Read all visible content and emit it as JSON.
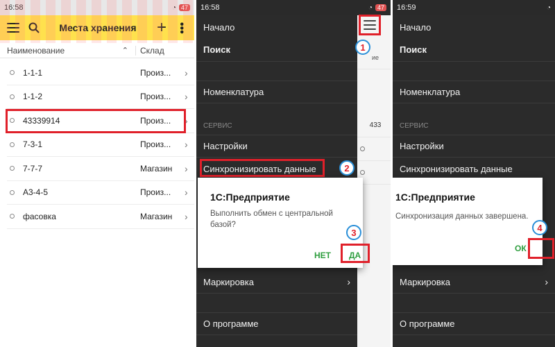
{
  "screen1": {
    "status_time": "16:58",
    "status_right": "47",
    "title": "Места хранения",
    "icons": {
      "menu": "hamburger-menu-icon",
      "search": "search-icon",
      "add": "plus-icon",
      "more": "more-vert-icon"
    },
    "columns": {
      "name": "Наименование",
      "sort_indicator": "^",
      "warehouse": "Склад"
    },
    "rows": [
      {
        "name": "1-1-1",
        "wh": "Произ..."
      },
      {
        "name": "1-1-2",
        "wh": "Произ..."
      },
      {
        "name": "43339914",
        "wh": "Произ..."
      },
      {
        "name": "7-3-1",
        "wh": "Произ..."
      },
      {
        "name": "7-7-7",
        "wh": "Магазин"
      },
      {
        "name": "А3-4-5",
        "wh": "Произ..."
      },
      {
        "name": "фасовка",
        "wh": "Магазин"
      }
    ]
  },
  "screen2": {
    "status_time": "16:58",
    "status_right": "47",
    "menu": {
      "start": "Начало",
      "search": "Поиск",
      "nomenclature": "Номенклатура",
      "service_header": "СЕРВИС",
      "settings": "Настройки",
      "sync": "Синхронизировать данные",
      "marking": "Маркировка",
      "about": "О программе"
    },
    "dialog": {
      "title": "1С:Предприятие",
      "message": "Выполнить обмен с центральной базой?",
      "no": "НЕТ",
      "yes": "ДА"
    },
    "strip_rows": [
      {
        "text": ""
      },
      {
        "text": ""
      },
      {
        "text": ""
      }
    ]
  },
  "screen3": {
    "status_time": "16:59",
    "menu": {
      "start": "Начало",
      "search": "Поиск",
      "nomenclature": "Номенклатура",
      "service_header": "СЕРВИС",
      "settings": "Настройки",
      "sync": "Синхронизировать данные",
      "marking": "Маркировка",
      "about": "О программе"
    },
    "dialog": {
      "title": "1С:Предприятие",
      "message": "Синхронизация данных завершена.",
      "ok": "ОК"
    }
  },
  "badges": [
    "1",
    "2",
    "3",
    "4"
  ],
  "colors": {
    "appbar": "#ffe14d",
    "highlight": "#e0202a",
    "menu_bg": "#2b2b2b",
    "dialog_button": "#2e9e3e",
    "badge_ring": "#2a8fd8"
  }
}
